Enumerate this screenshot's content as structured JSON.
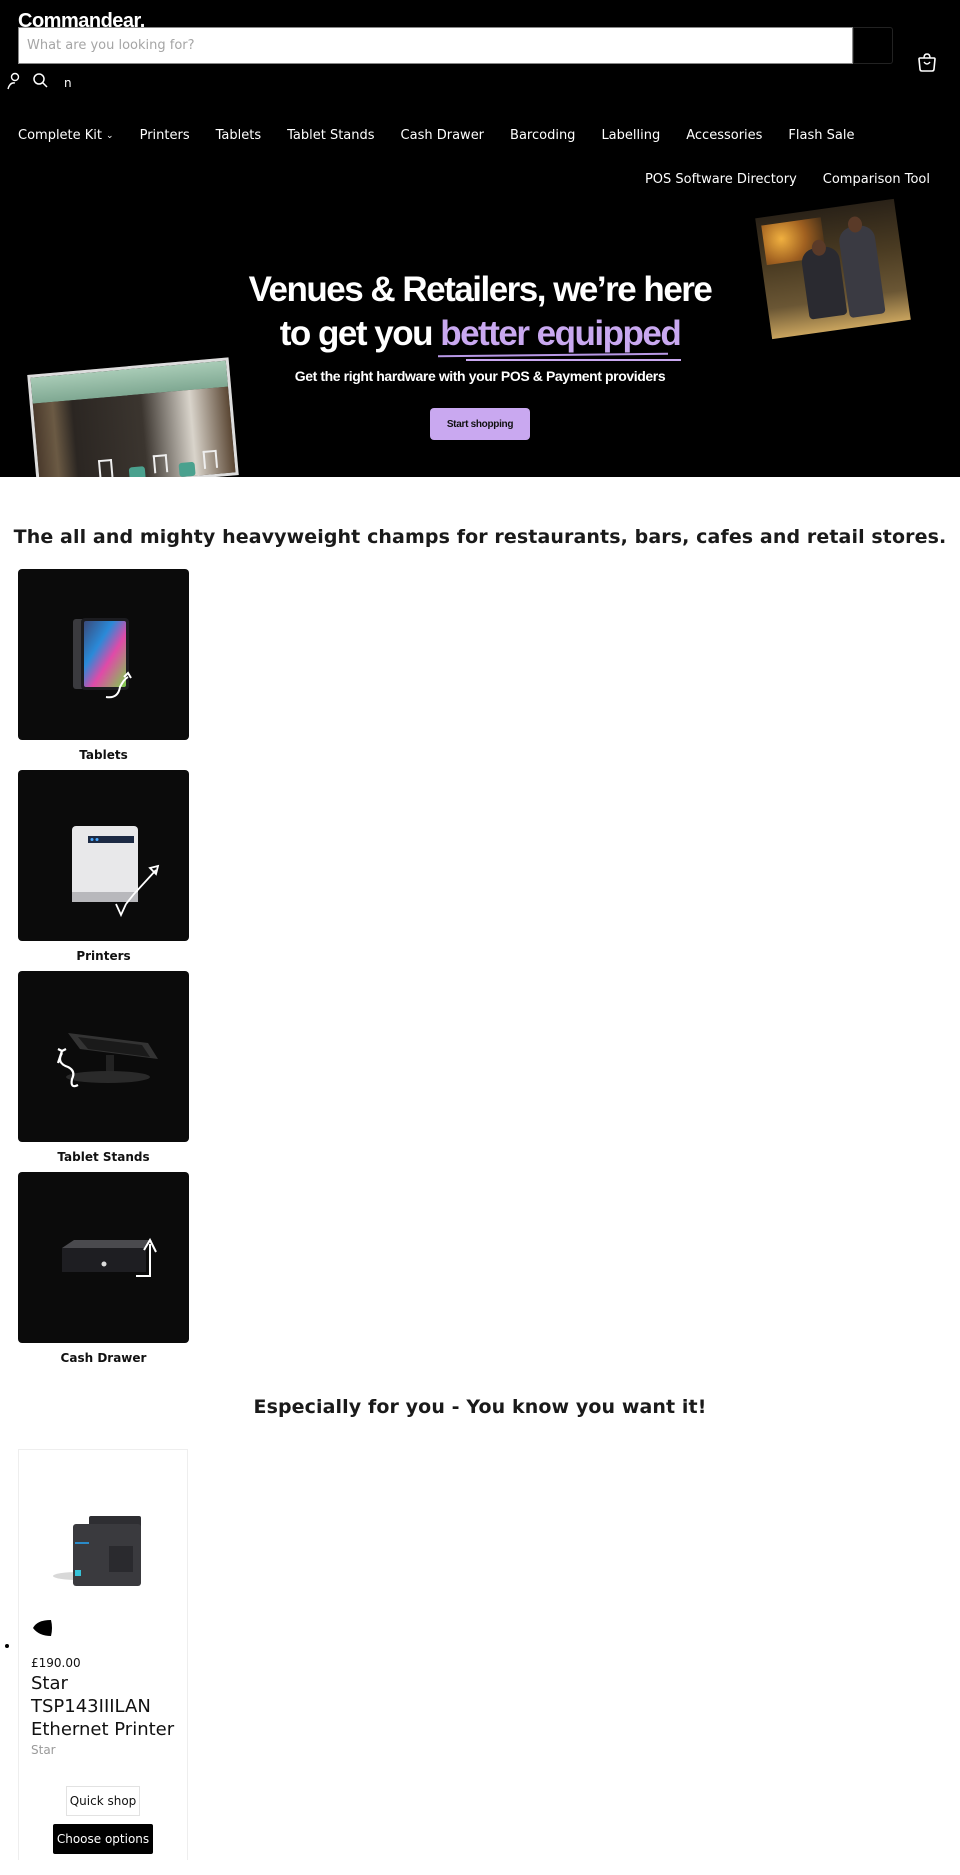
{
  "header": {
    "logo": "Commandear.",
    "search": {
      "placeholder": "What are you looking for?",
      "value": ""
    },
    "utility_text": "n",
    "icons": {
      "account": "account-icon",
      "search": "search-icon",
      "cart": "shopping-bag-icon"
    }
  },
  "nav": {
    "primary": [
      {
        "label": "Complete Kit",
        "has_dropdown": true
      },
      {
        "label": "Printers"
      },
      {
        "label": "Tablets"
      },
      {
        "label": "Tablet Stands"
      },
      {
        "label": "Cash Drawer"
      },
      {
        "label": "Barcoding"
      },
      {
        "label": "Labelling"
      },
      {
        "label": "Accessories"
      },
      {
        "label": "Flash Sale"
      }
    ],
    "secondary": [
      {
        "label": "POS Software Directory"
      },
      {
        "label": "Comparison Tool"
      }
    ],
    "dropdown_glyph": "⌄"
  },
  "hero": {
    "title_line1": "Venues & Retailers, we’re here",
    "title_line2_plain": "to get you ",
    "title_line2_accent": "better equipped",
    "subtitle": "Get the right hardware with your POS & Payment providers",
    "cta_label": "Start shopping",
    "accent_color": "#c9a8f0"
  },
  "categories_section": {
    "title": "The all and mighty heavyweight champs for restaurants, bars, cafes and retail stores.",
    "items": [
      {
        "label": "Tablets",
        "icon": "tablet-icon"
      },
      {
        "label": "Printers",
        "icon": "printer-icon"
      },
      {
        "label": "Tablet Stands",
        "icon": "tablet-stand-icon"
      },
      {
        "label": "Cash Drawer",
        "icon": "cash-drawer-icon"
      }
    ]
  },
  "featured_section": {
    "title": "Especially for you - You know you want it!",
    "products": [
      {
        "price": "£190.00",
        "name": "Star TSP143IIILAN Ethernet Printer",
        "vendor": "Star",
        "quick_shop_label": "Quick shop",
        "choose_options_label": "Choose options"
      }
    ]
  }
}
